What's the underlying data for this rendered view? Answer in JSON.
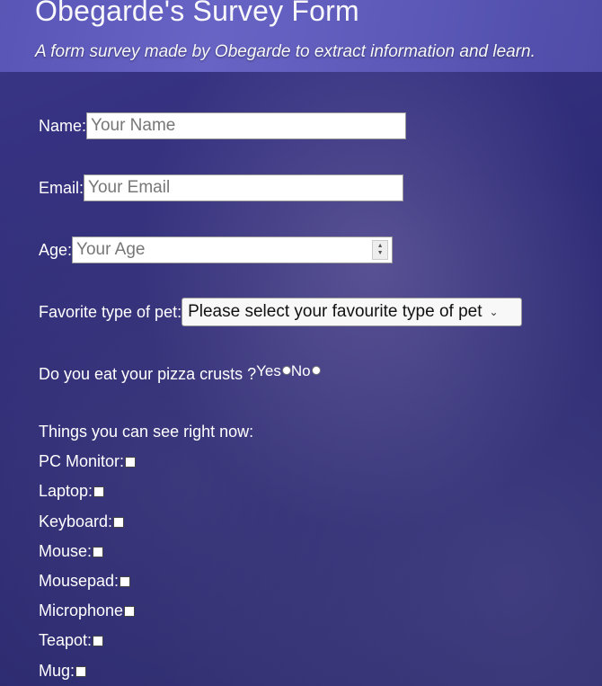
{
  "header": {
    "title": "Obegarde's Survey Form",
    "subtitle": "A form survey made by Obegarde to extract information and learn."
  },
  "form": {
    "name": {
      "label": "Name:",
      "placeholder": "Your Name"
    },
    "email": {
      "label": "Email:",
      "placeholder": "Your Email"
    },
    "age": {
      "label": "Age:",
      "placeholder": "Your Age"
    },
    "pet": {
      "label": "Favorite type of pet:",
      "selected": "Please select your favourite type of pet"
    },
    "pizza": {
      "question": "Do you eat your pizza crusts ?",
      "options": [
        "Yes",
        "No"
      ]
    },
    "things": {
      "heading": "Things you can see right now:",
      "items": [
        "PC Monitor:",
        "Laptop:",
        "Keyboard:",
        "Mouse:",
        "Mousepad:",
        "Microphone",
        "Teapot:",
        "Mug:"
      ]
    }
  }
}
